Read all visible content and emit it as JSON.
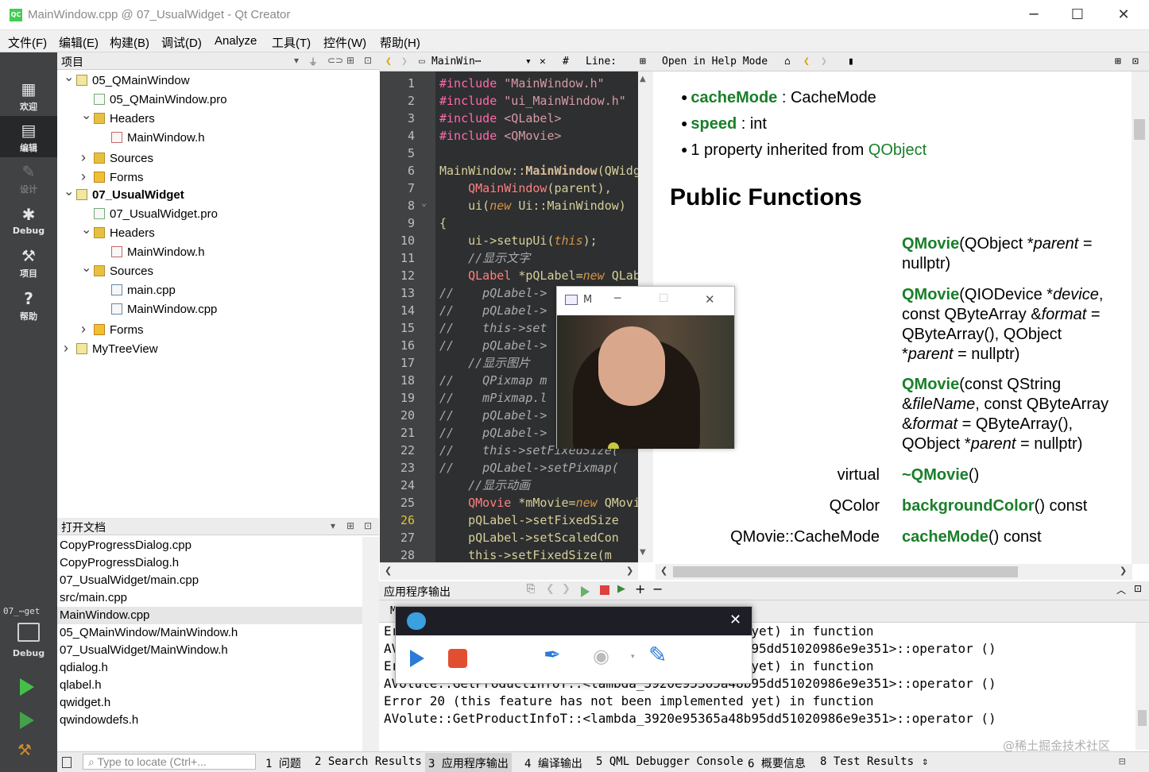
{
  "window": {
    "title": "MainWindow.cpp @ 07_UsualWidget - Qt Creator",
    "app_icon": "QC",
    "minimize_label": "─",
    "maximize_label": "☐",
    "close_label": "✕"
  },
  "menu": [
    "文件(F)",
    "编辑(E)",
    "构建(B)",
    "调试(D)",
    "Analyze",
    "工具(T)",
    "控件(W)",
    "帮助(H)"
  ],
  "modes": [
    {
      "label": "欢迎",
      "icon": "grid-icon"
    },
    {
      "label": "编辑",
      "icon": "edit-icon"
    },
    {
      "label": "设计",
      "icon": "pencil-icon"
    },
    {
      "label": "Debug",
      "icon": "bug-icon"
    },
    {
      "label": "项目",
      "icon": "wrench-icon"
    },
    {
      "label": "帮助",
      "icon": "help-icon"
    }
  ],
  "kit": {
    "name": "07_⋯get",
    "mode": "Debug"
  },
  "projects": {
    "header": "项目",
    "items": [
      {
        "text": "05_QMainWindow",
        "indent": 0,
        "arrow": "open",
        "icon": "proj"
      },
      {
        "text": "05_QMainWindow.pro",
        "indent": 1,
        "arrow": "",
        "icon": "pro"
      },
      {
        "text": "Headers",
        "indent": 1,
        "arrow": "open",
        "icon": "fold"
      },
      {
        "text": "MainWindow.h",
        "indent": 2,
        "arrow": "",
        "icon": "hdr"
      },
      {
        "text": "Sources",
        "indent": 1,
        "arrow": "closed",
        "icon": "fold"
      },
      {
        "text": "Forms",
        "indent": 1,
        "arrow": "closed",
        "icon": "form"
      },
      {
        "text": "07_UsualWidget",
        "indent": 0,
        "arrow": "open",
        "icon": "proj",
        "bold": true
      },
      {
        "text": "07_UsualWidget.pro",
        "indent": 1,
        "arrow": "",
        "icon": "pro"
      },
      {
        "text": "Headers",
        "indent": 1,
        "arrow": "open",
        "icon": "fold"
      },
      {
        "text": "MainWindow.h",
        "indent": 2,
        "arrow": "",
        "icon": "hdr"
      },
      {
        "text": "Sources",
        "indent": 1,
        "arrow": "open",
        "icon": "fold"
      },
      {
        "text": "main.cpp",
        "indent": 2,
        "arrow": "",
        "icon": "cpp"
      },
      {
        "text": "MainWindow.cpp",
        "indent": 2,
        "arrow": "",
        "icon": "cpp"
      },
      {
        "text": "Forms",
        "indent": 1,
        "arrow": "closed",
        "icon": "form"
      },
      {
        "text": "MyTreeView",
        "indent": 0,
        "arrow": "closed",
        "icon": "proj"
      }
    ]
  },
  "open_docs": {
    "header": "打开文档",
    "items": [
      "CopyProgressDialog.cpp",
      "CopyProgressDialog.h",
      "07_UsualWidget/main.cpp",
      "src/main.cpp",
      "MainWindow.cpp",
      "05_QMainWindow/MainWindow.h",
      "07_UsualWidget/MainWindow.h",
      "qdialog.h",
      "qlabel.h",
      "qwidget.h",
      "qwindowdefs.h"
    ],
    "selected": 4
  },
  "editor_toolbar": {
    "file": "MainWin⋯",
    "hash": "#",
    "line": "Line:",
    "help_mode": "Open in Help Mode"
  },
  "code_lines": [
    [
      [
        "mac",
        "#include "
      ],
      [
        "str",
        "\"MainWindow.h\""
      ]
    ],
    [
      [
        "mac",
        "#include "
      ],
      [
        "str",
        "\"ui_MainWindow.h\""
      ]
    ],
    [
      [
        "mac",
        "#include "
      ],
      [
        "str",
        "<QLabel>"
      ]
    ],
    [
      [
        "mac",
        "#include "
      ],
      [
        "str",
        "<QMovie>"
      ]
    ],
    [],
    [
      [
        "plain",
        "MainWindow::"
      ],
      [
        "fn",
        "MainWindow"
      ],
      [
        "plain",
        "(QWidget *parent)"
      ]
    ],
    [
      [
        "plain",
        "    "
      ],
      [
        "ty",
        "QMainWindow"
      ],
      [
        "plain",
        "(parent),"
      ]
    ],
    [
      [
        "plain",
        "    ui("
      ],
      [
        "it",
        "new"
      ],
      [
        "plain",
        " Ui::MainWindow)"
      ]
    ],
    [
      [
        "plain",
        "{"
      ]
    ],
    [
      [
        "plain",
        "    ui->setupUi("
      ],
      [
        "it",
        "this"
      ],
      [
        "plain",
        ");"
      ]
    ],
    [
      [
        "cm",
        "    //显示文字"
      ]
    ],
    [
      [
        "plain",
        "    "
      ],
      [
        "ty",
        "QLabel"
      ],
      [
        "plain",
        " *pQLabel="
      ],
      [
        "it",
        "new"
      ],
      [
        "plain",
        " QLabel"
      ]
    ],
    [
      [
        "cm",
        "//    pQLabel->"
      ]
    ],
    [
      [
        "cm",
        "//    pQLabel->"
      ]
    ],
    [
      [
        "cm",
        "//    this->set"
      ]
    ],
    [
      [
        "cm",
        "//    pQLabel->"
      ]
    ],
    [
      [
        "cm",
        "    //显示图片"
      ]
    ],
    [
      [
        "cm",
        "//    QPixmap m"
      ]
    ],
    [
      [
        "cm",
        "//    mPixmap.l"
      ]
    ],
    [
      [
        "cm",
        "//    pQLabel->"
      ]
    ],
    [
      [
        "cm",
        "//    pQLabel->"
      ]
    ],
    [
      [
        "cm",
        "//    this->setFixedSize("
      ]
    ],
    [
      [
        "cm",
        "//    pQLabel->setPixmap("
      ]
    ],
    [
      [
        "cm",
        "    //显示动画"
      ]
    ],
    [
      [
        "plain",
        "    "
      ],
      [
        "ty",
        "QMovie"
      ],
      [
        "plain",
        " *mMovie="
      ],
      [
        "it",
        "new"
      ],
      [
        "plain",
        " QMovie"
      ]
    ],
    [
      [
        "plain",
        "    pQLabel->setFixedSize"
      ]
    ],
    [
      [
        "plain",
        "    pQLabel->setScaledCon"
      ]
    ],
    [
      [
        "plain",
        "    this->setFixedSize(m"
      ]
    ]
  ],
  "current_line": 26,
  "help": {
    "properties": [
      {
        "name": "cacheMode",
        "rest": " : CacheMode"
      },
      {
        "name": "speed",
        "rest": " : int"
      }
    ],
    "inherited_text": "1 property inherited from ",
    "inherited_link": "QObject",
    "section": "Public Functions",
    "functions": [
      {
        "ret": "",
        "lines": [
          [
            [
              "g",
              "QMovie"
            ],
            [
              "n",
              "(QObject *"
            ],
            [
              "i",
              "parent"
            ],
            [
              "n",
              " ="
            ]
          ],
          [
            [
              "n",
              "nullptr)"
            ]
          ]
        ]
      },
      {
        "ret": "",
        "lines": [
          [
            [
              "g",
              "QMovie"
            ],
            [
              "n",
              "(QIODevice *"
            ],
            [
              "i",
              "device"
            ],
            [
              "n",
              ","
            ]
          ],
          [
            [
              "n",
              "const QByteArray &"
            ],
            [
              "i",
              "format"
            ],
            [
              "n",
              " ="
            ]
          ],
          [
            [
              "n",
              "QByteArray(), QObject"
            ]
          ],
          [
            [
              "n",
              "*"
            ],
            [
              "i",
              "parent"
            ],
            [
              "n",
              " = nullptr)"
            ]
          ]
        ]
      },
      {
        "ret": "",
        "lines": [
          [
            [
              "g",
              "QMovie"
            ],
            [
              "n",
              "(const QString"
            ]
          ],
          [
            [
              "n",
              "&"
            ],
            [
              "i",
              "fileName"
            ],
            [
              "n",
              ", const QByteArray"
            ]
          ],
          [
            [
              "n",
              "&"
            ],
            [
              "i",
              "format"
            ],
            [
              "n",
              " = QByteArray(),"
            ]
          ],
          [
            [
              "n",
              "QObject *"
            ],
            [
              "i",
              "parent"
            ],
            [
              "n",
              " = nullptr)"
            ]
          ]
        ]
      },
      {
        "ret": "virtual",
        "lines": [
          [
            [
              "g",
              "~QMovie"
            ],
            [
              "n",
              "()"
            ]
          ]
        ]
      },
      {
        "ret": "QColor",
        "lines": [
          [
            [
              "g",
              "backgroundColor"
            ],
            [
              "n",
              "() const"
            ]
          ]
        ]
      },
      {
        "ret": "QMovie::CacheMode",
        "lines": [
          [
            [
              "g",
              "cacheMode"
            ],
            [
              "n",
              "() const"
            ]
          ]
        ]
      }
    ]
  },
  "output": {
    "header": "应用程序输出",
    "lines": [
      "Er                                            d yet) in function",
      "AV                                            8b95dd51020986e9e351>::operator ()",
      "Er                                            d yet) in function",
      "AVolute::GetProductInfoT::<lambda_3920e95365a48b95dd51020986e9e351>::operator ()",
      "Error 20 (this feature has not been implemented yet) in function",
      "AVolute::GetProductInfoT::<lambda_3920e95365a48b95dd51020986e9e351>::operator ()"
    ],
    "tab_stub": "M"
  },
  "video_window": {
    "title": "M",
    "min": "─",
    "max": "☐",
    "close": "✕"
  },
  "recorder": {
    "close": "✕"
  },
  "statusbar": {
    "locator_placeholder": "Type to locate (Ctrl+...",
    "tabs": [
      "1 问题",
      "2 Search Results",
      "3 应用程序输出",
      "4 编译输出",
      "5 QML Debugger Console",
      "6 概要信息",
      "8 Test Results"
    ],
    "active": 2
  },
  "watermark": "@稀土掘金技术社区",
  "colors": {
    "modebar": "#404244",
    "editor_bg": "#2e2f30",
    "help_green": "#1a7f2a"
  }
}
